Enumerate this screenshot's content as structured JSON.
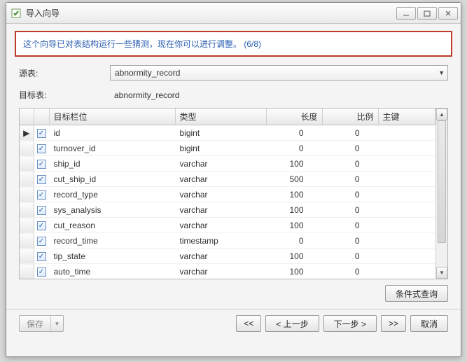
{
  "window": {
    "title": "导入向导"
  },
  "banner": {
    "text": "这个向导已对表结构运行一些猜测，现在你可以进行调整。 (6/8)"
  },
  "form": {
    "source_label": "源表:",
    "source_value": "abnormity_record",
    "target_label": "目标表:",
    "target_value": "abnormity_record"
  },
  "grid": {
    "columns": {
      "field": "目标栏位",
      "type": "类型",
      "length": "长度",
      "scale": "比例",
      "pk": "主键"
    },
    "rows": [
      {
        "mark": "▶",
        "checked": true,
        "field": "id",
        "type": "bigint",
        "length": 0,
        "scale": 0
      },
      {
        "mark": "",
        "checked": true,
        "field": "turnover_id",
        "type": "bigint",
        "length": 0,
        "scale": 0
      },
      {
        "mark": "",
        "checked": true,
        "field": "ship_id",
        "type": "varchar",
        "length": 100,
        "scale": 0
      },
      {
        "mark": "",
        "checked": true,
        "field": "cut_ship_id",
        "type": "varchar",
        "length": 500,
        "scale": 0
      },
      {
        "mark": "",
        "checked": true,
        "field": "record_type",
        "type": "varchar",
        "length": 100,
        "scale": 0
      },
      {
        "mark": "",
        "checked": true,
        "field": "sys_analysis",
        "type": "varchar",
        "length": 100,
        "scale": 0
      },
      {
        "mark": "",
        "checked": true,
        "field": "cut_reason",
        "type": "varchar",
        "length": 100,
        "scale": 0
      },
      {
        "mark": "",
        "checked": true,
        "field": "record_time",
        "type": "timestamp",
        "length": 0,
        "scale": 0
      },
      {
        "mark": "",
        "checked": true,
        "field": "tip_state",
        "type": "varchar",
        "length": 100,
        "scale": 0
      },
      {
        "mark": "",
        "checked": true,
        "field": "auto_time",
        "type": "varchar",
        "length": 100,
        "scale": 0
      }
    ]
  },
  "buttons": {
    "condition_query": "条件式查询",
    "save": "保存",
    "first": "<<",
    "prev": "< 上一步",
    "next": "下一步 >",
    "last": ">>",
    "cancel": "取消"
  }
}
